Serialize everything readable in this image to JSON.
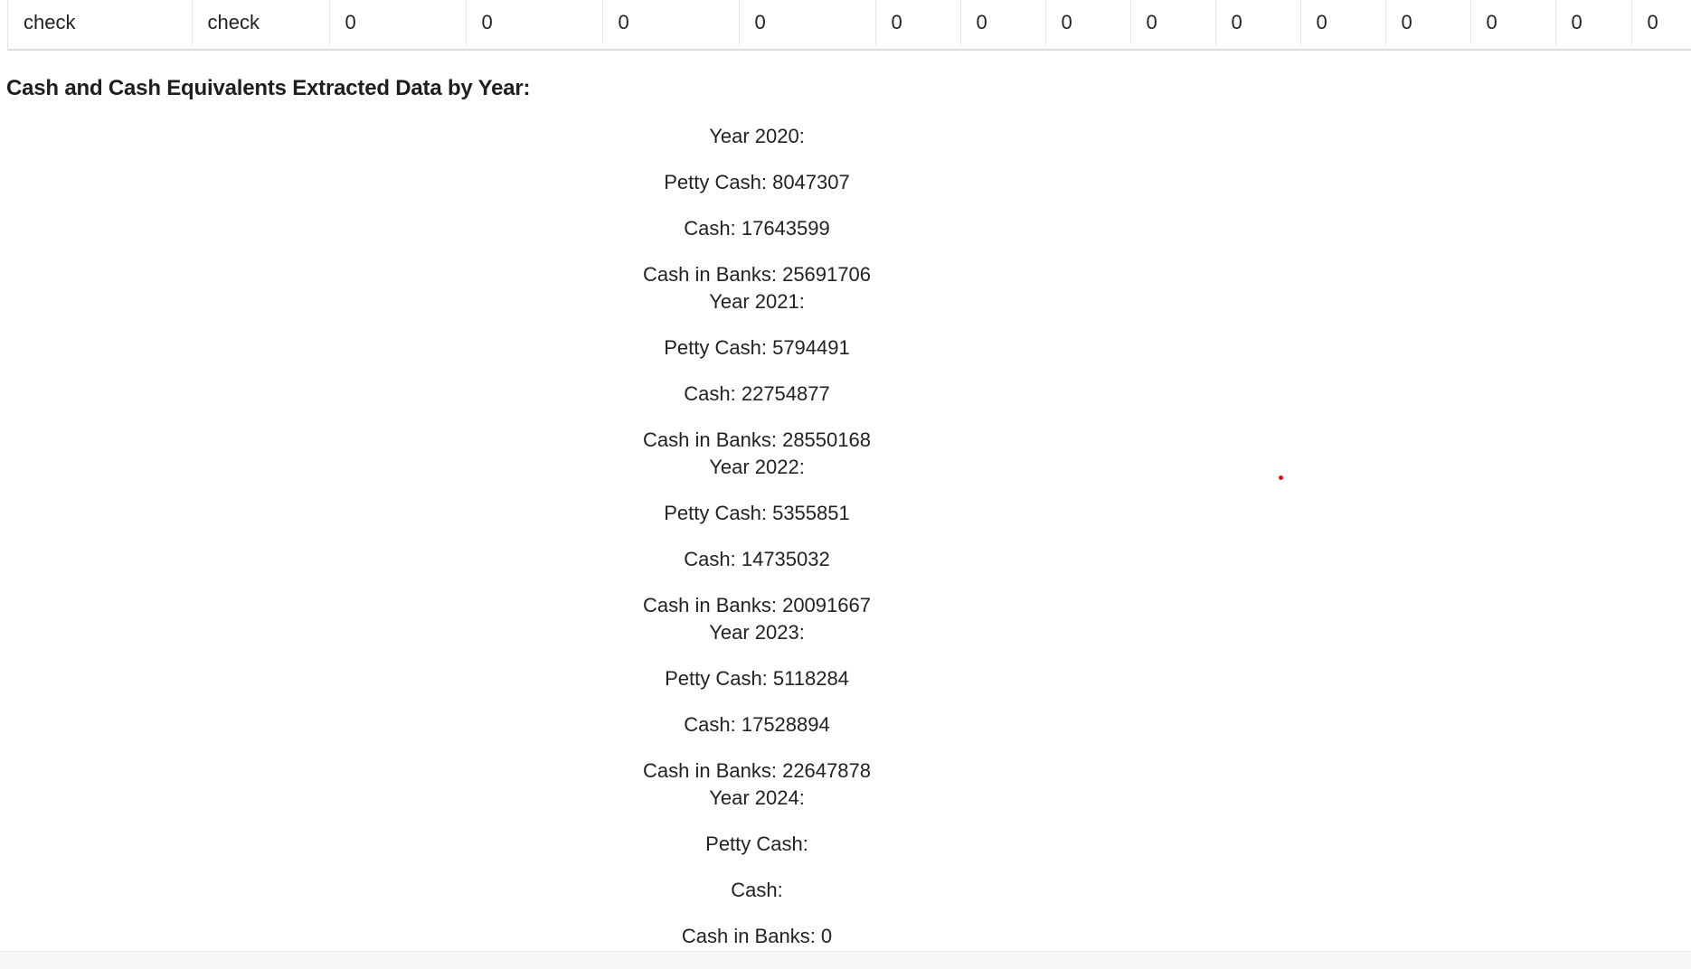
{
  "table": {
    "row": [
      "check",
      "check",
      "0",
      "0",
      "0",
      "0",
      "0",
      "0",
      "0",
      "0",
      "0",
      "0",
      "0",
      "0",
      "0",
      "0"
    ]
  },
  "heading": "Cash and Cash Equivalents Extracted Data by Year:",
  "years": [
    {
      "year_label": "Year 2020:",
      "petty_cash": "Petty Cash: 8047307",
      "cash": "Cash: 17643599",
      "cash_in_banks": "Cash in Banks: 25691706"
    },
    {
      "year_label": "Year 2021:",
      "petty_cash": "Petty Cash: 5794491",
      "cash": "Cash: 22754877",
      "cash_in_banks": "Cash in Banks: 28550168"
    },
    {
      "year_label": "Year 2022:",
      "petty_cash": "Petty Cash: 5355851",
      "cash": "Cash: 14735032",
      "cash_in_banks": "Cash in Banks: 20091667"
    },
    {
      "year_label": "Year 2023:",
      "petty_cash": "Petty Cash: 5118284",
      "cash": "Cash: 17528894",
      "cash_in_banks": "Cash in Banks: 22647878"
    },
    {
      "year_label": "Year 2024:",
      "petty_cash": "Petty Cash:",
      "cash": "Cash:",
      "cash_in_banks": "Cash in Banks: 0"
    }
  ],
  "colors": {
    "marker_dot": "#d6171a"
  }
}
